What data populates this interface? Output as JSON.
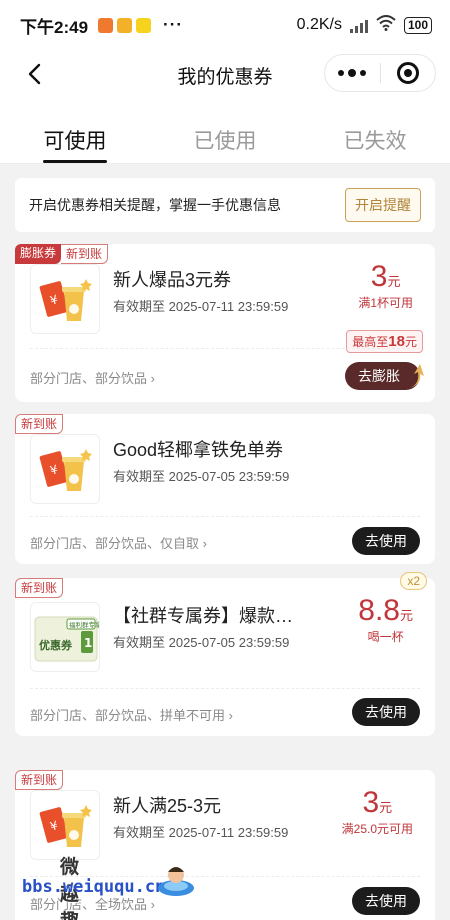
{
  "status_bar": {
    "time": "下午2:49",
    "network_speed": "0.2K/s",
    "battery": "100",
    "app_badges": [
      "#ef7a2f",
      "#f3b129",
      "#f7d21e"
    ]
  },
  "nav": {
    "title": "我的优惠券"
  },
  "tabs": [
    {
      "label": "可使用",
      "active": true
    },
    {
      "label": "已使用",
      "active": false
    },
    {
      "label": "已失效",
      "active": false
    }
  ],
  "reminder": {
    "text": "开启优惠券相关提醒，掌握一手优惠信息",
    "button": "开启提醒"
  },
  "coupons": [
    {
      "tags": [
        "膨胀券",
        "新到账"
      ],
      "title": "新人爆品3元券",
      "validity": "有效期至 2025-07-11 23:59:59",
      "price": "3",
      "unit": "元",
      "condition": "满1杯可用",
      "max_badge_prefix": "最高至",
      "max_badge_value": "18",
      "max_badge_unit": "元",
      "scope": "部分门店、部分饮品",
      "action": "去膨胀"
    },
    {
      "tags": [
        "新到账"
      ],
      "title": "Good轻椰拿铁免单券",
      "validity": "有效期至 2025-07-05 23:59:59",
      "scope": "部分门店、部分饮品、仅自取",
      "action": "去使用"
    },
    {
      "tags": [
        "新到账"
      ],
      "title": "【社群专属券】爆款…",
      "validity": "有效期至 2025-07-05 23:59:59",
      "price": "8.8",
      "unit": "元",
      "condition": "喝一杯",
      "multiplier": "x2",
      "thumb_label": "优惠券",
      "thumb_badge": "福利群专享",
      "scope": "部分门店、部分饮品、拼单不可用",
      "action": "去使用"
    },
    {
      "tags": [
        "新到账"
      ],
      "title": "新人满25-3元",
      "validity": "有效期至 2025-07-11 23:59:59",
      "price": "3",
      "unit": "元",
      "condition": "满25.0元可用",
      "scope": "部分门店、全场饮品",
      "action": "去使用"
    }
  ],
  "watermark": {
    "cn": "微趣趣",
    "url": "bbs.weiququ.cn"
  }
}
